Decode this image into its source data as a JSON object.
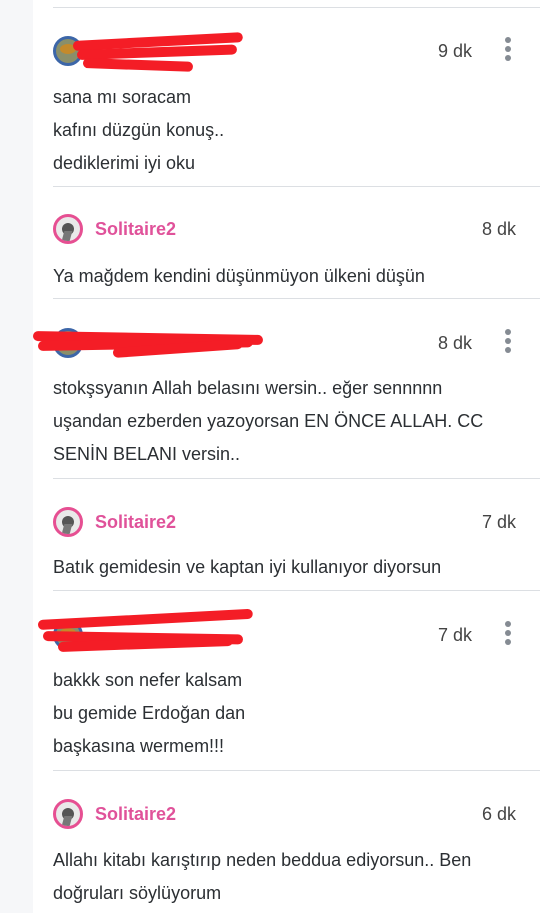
{
  "comments": [
    {
      "username": "",
      "time": "9 dk",
      "lines": [
        "sana mı soracam",
        "kafını düzgün konuş..",
        "dediklerimi iyi oku"
      ]
    },
    {
      "username": "Solitaire2",
      "time": "8 dk",
      "lines": [
        "Ya mağdem kendini düşünmüyon ülkeni düşün"
      ]
    },
    {
      "username": "",
      "time": "8 dk",
      "lines": [
        "stokşsyanın Allah belasını wersin.. eğer sennnnn",
        "uşandan ezberden yazoyorsan EN ÖNCE ALLAH. CC",
        "SENİN BELANI versin.."
      ]
    },
    {
      "username": "Solitaire2",
      "time": "7 dk",
      "lines": [
        "Batık gemidesin ve kaptan iyi kullanıyor diyorsun"
      ]
    },
    {
      "username": "",
      "time": "7 dk",
      "lines": [
        "bakkk son nefer kalsam",
        "bu gemide Erdoğan dan",
        "başkasına wermem!!!"
      ]
    },
    {
      "username": "Solitaire2",
      "time": "6 dk",
      "lines": [
        "Allahı kitabı karıştırıp neden beddua ediyorsun.. Ben",
        "doğruları söylüyorum"
      ]
    }
  ],
  "icons": {
    "menu": "more-vertical-icon",
    "avatar": "user-avatar-icon"
  },
  "colors": {
    "username": "#e0529a",
    "redaction": "#f41d26",
    "divider": "#dcdfe3"
  }
}
